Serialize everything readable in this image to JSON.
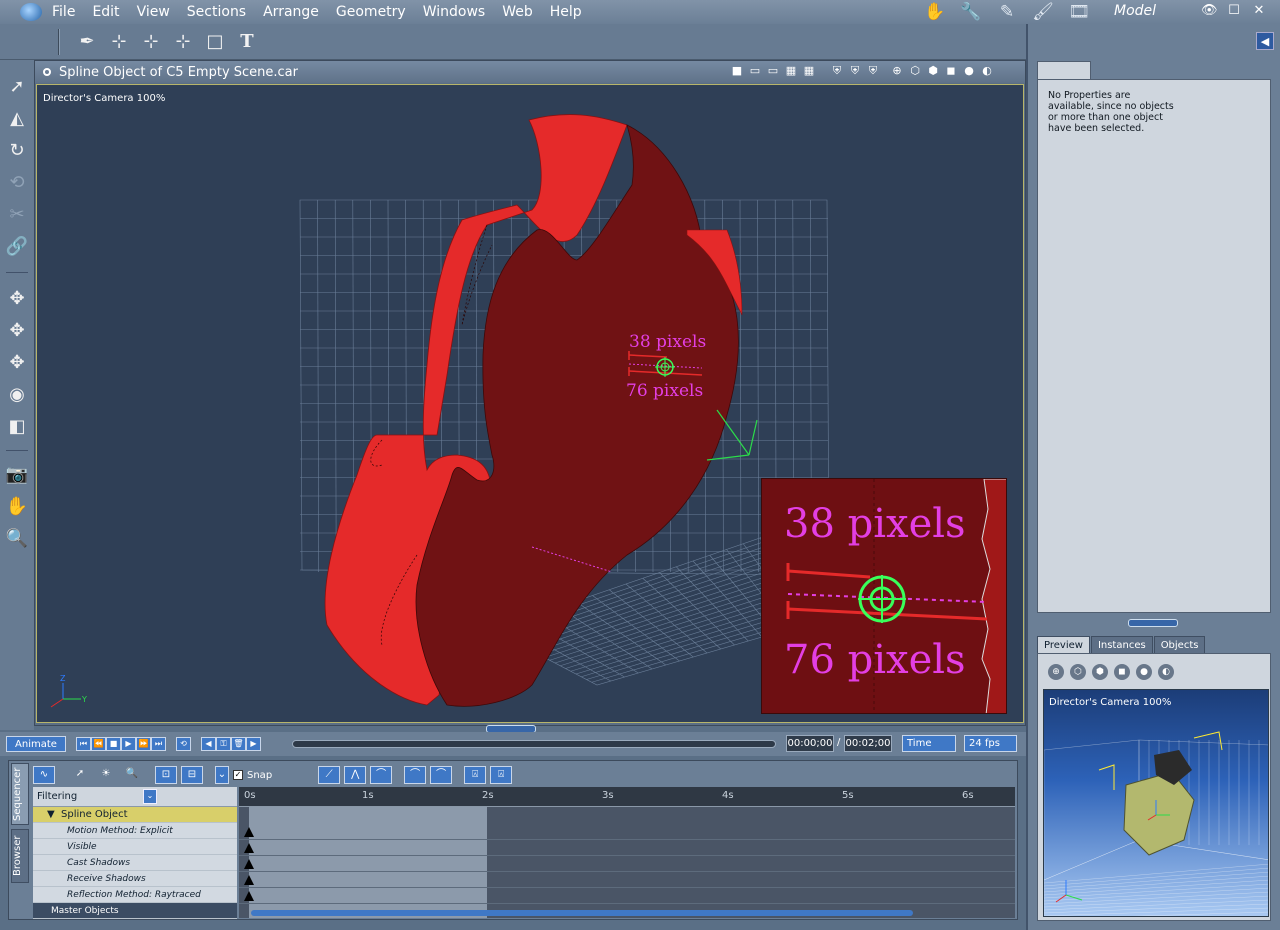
{
  "menubar": {
    "items": [
      "File",
      "Edit",
      "View",
      "Sections",
      "Arrange",
      "Geometry",
      "Windows",
      "Web",
      "Help"
    ],
    "room_icons": [
      "hand-room-icon",
      "wrench-room-icon",
      "pencil-room-icon",
      "brush-room-icon",
      "film-room-icon"
    ],
    "room_label": "Model"
  },
  "document": {
    "title": "Spline Object of C5 Empty Scene.car",
    "camera_label": "Director's Camera 100%",
    "inset": {
      "top_label": "38 pixels",
      "bottom_label": "76 pixels"
    },
    "viewport_annotations": {
      "top_label": "38 pixels",
      "bottom_label": "76 pixels"
    },
    "colors": {
      "object_red": "#e52a2a",
      "object_dark": "#6e0f12",
      "annotation_magenta": "#e33fe3",
      "target_green": "#39ff5a"
    }
  },
  "properties": {
    "message": "No Properties are available, since no objects or more than one object have been selected."
  },
  "preview": {
    "tabs": [
      "Preview",
      "Instances",
      "Objects"
    ],
    "active_tab": "Preview",
    "camera_label": "Director's Camera 100%"
  },
  "transport": {
    "animate_label": "Animate",
    "current_time": "00:00;00",
    "separator": "/",
    "end_time": "00:02;00",
    "time_mode": "Time",
    "fps": "24 fps"
  },
  "sequencer": {
    "side_tabs": [
      "Sequencer",
      "Browser"
    ],
    "snap_label": "Snap",
    "snap_checked": true,
    "filter_label": "Filtering",
    "object_name": "Spline Object",
    "tracks": [
      {
        "label": "Motion Method: Explicit"
      },
      {
        "label": "Visible"
      },
      {
        "label": "Cast Shadows"
      },
      {
        "label": "Receive Shadows"
      },
      {
        "label": "Reflection Method: Raytraced"
      }
    ],
    "master_label": "Master Objects",
    "ruler_ticks": [
      "0s",
      "1s",
      "2s",
      "3s",
      "4s",
      "5s",
      "6s"
    ]
  }
}
